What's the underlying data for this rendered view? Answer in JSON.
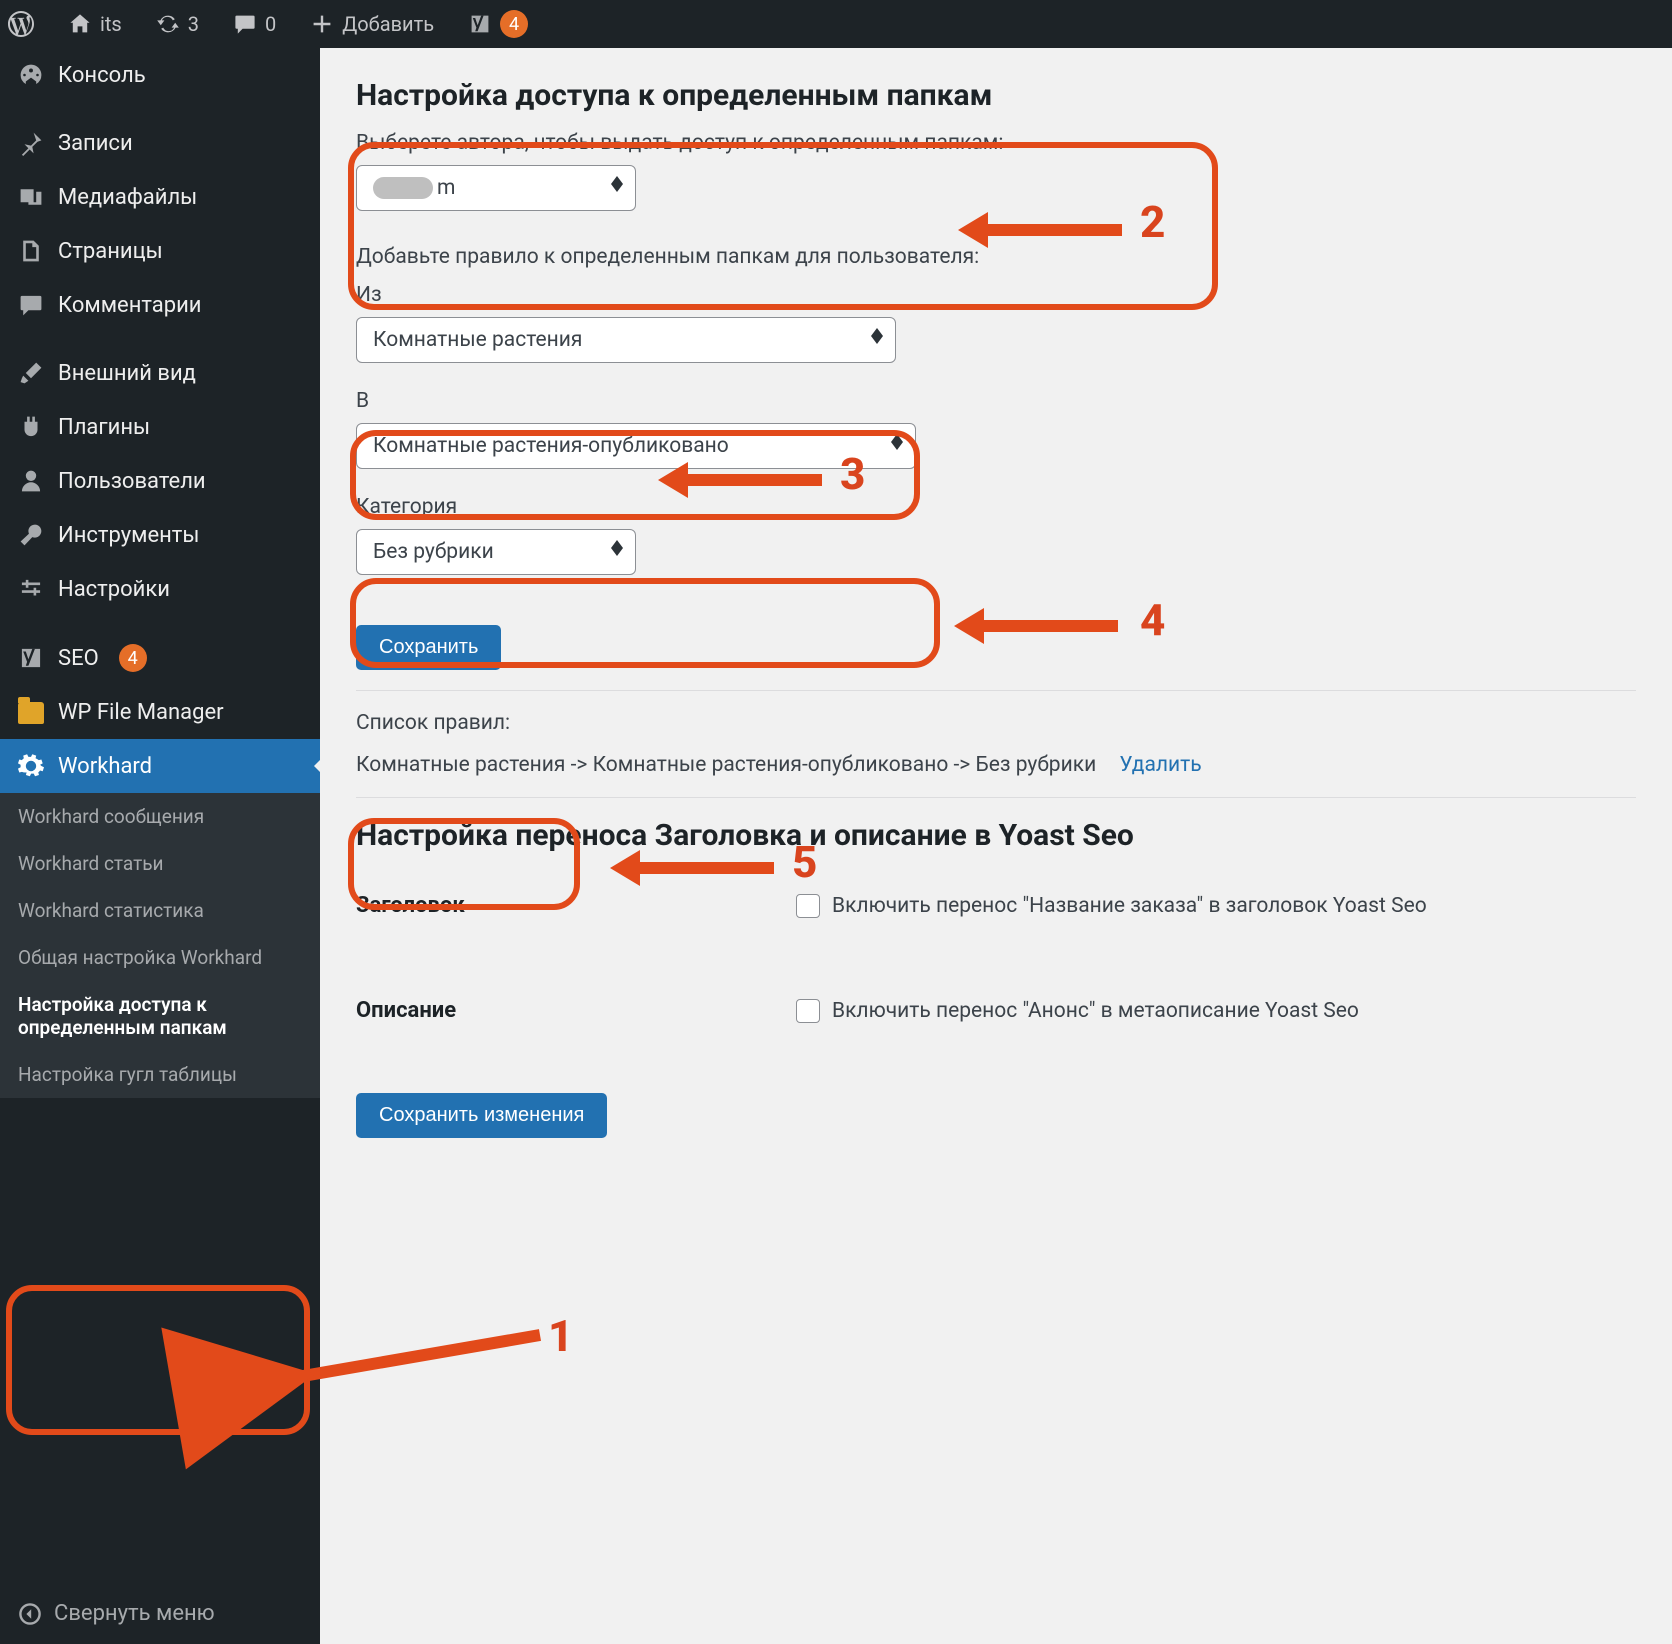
{
  "adminbar": {
    "site_name": "its",
    "refresh_count": "3",
    "comments_count": "0",
    "add_label": "Добавить",
    "yoast_badge": "4"
  },
  "sidebar": {
    "items": [
      {
        "label": "Консоль"
      },
      {
        "label": "Записи"
      },
      {
        "label": "Медиафайлы"
      },
      {
        "label": "Страницы"
      },
      {
        "label": "Комментарии"
      },
      {
        "label": "Внешний вид"
      },
      {
        "label": "Плагины"
      },
      {
        "label": "Пользователи"
      },
      {
        "label": "Инструменты"
      },
      {
        "label": "Настройки"
      },
      {
        "label": "SEO",
        "badge": "4"
      },
      {
        "label": "WP File Manager"
      },
      {
        "label": "Workhard"
      }
    ],
    "submenu": [
      "Workhard сообщения",
      "Workhard статьи",
      "Workhard статистика",
      "Общая настройка Workhard",
      "Настройка доступа к определенным папкам",
      "Настройка гугл таблицы"
    ],
    "collapse": "Свернуть меню"
  },
  "content": {
    "h1": "Настройка доступа к определенным папкам",
    "author_prompt": "Выберете автора, чтобы выдать доступ к определенным папкам:",
    "author_value_tail": "m",
    "rule_prompt": "Добавьте правило к определенным папкам для пользователя:",
    "from_label": "Из",
    "from_value": "Комнатные растения",
    "to_label": "В",
    "to_value": "Комнатные растения-опубликовано",
    "cat_label": "Категория",
    "cat_value": "Без рубрики",
    "save_btn": "Сохранить",
    "rules_title": "Список правил:",
    "rule_text": "Комнатные растения -> Комнатные растения-опубликовано -> Без рубрики",
    "delete_link": "Удалить",
    "yoast_h2": "Настройка переноса Заголовка и описание в Yoast Seo",
    "title_th": "Заголовок",
    "title_cb": "Включить перенос \"Название заказа\" в заголовок Yoast Seo",
    "desc_th": "Описание",
    "desc_cb": "Включить перенос \"Анонс\" в метаописание Yoast Seo",
    "save_changes": "Сохранить изменения"
  },
  "annotations": {
    "n1": "1",
    "n2": "2",
    "n3": "3",
    "n4": "4",
    "n5": "5"
  }
}
